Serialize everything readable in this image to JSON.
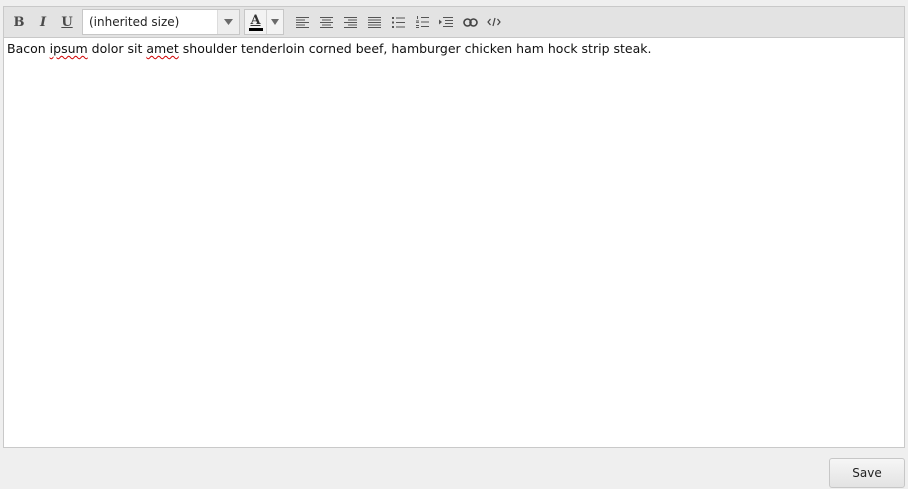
{
  "toolbar": {
    "buttons": {
      "bold": "B",
      "italic": "I",
      "underline": "U"
    },
    "font_size": {
      "selected": "(inherited size)"
    },
    "font_color": {
      "letter": "A",
      "swatch_color": "#000000"
    },
    "icons": [
      "align-left-icon",
      "align-center-icon",
      "align-right-icon",
      "align-justify-icon",
      "bulleted-list-icon",
      "numbered-list-icon",
      "indent-icon",
      "link-icon",
      "source-code-icon"
    ]
  },
  "editor": {
    "text_parts": {
      "p1": "Bacon ",
      "w1": "ipsum",
      "p2": " dolor sit ",
      "w2": "amet",
      "p3": " shoulder tenderloin corned beef, hamburger chicken ham hock strip steak."
    },
    "spellcheck_color": "#d00000"
  },
  "actions": {
    "save_label": "Save"
  }
}
